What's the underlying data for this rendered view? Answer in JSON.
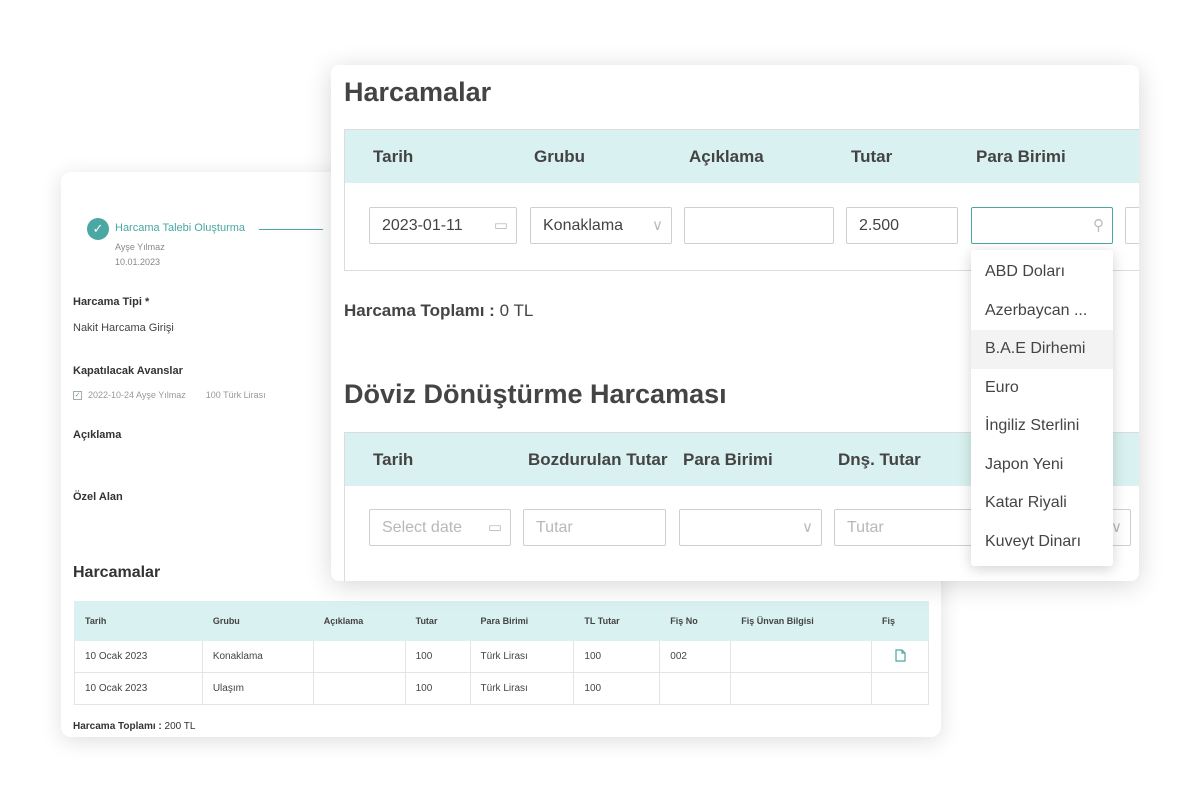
{
  "back": {
    "step": {
      "title": "Harcama Talebi Oluşturma",
      "user": "Ayşe Yılmaz",
      "date": "10.01.2023"
    },
    "fields": {
      "harcama_tipi_label": "Harcama Tipi *",
      "harcama_tipi_value": "Nakit Harcama Girişi",
      "avans_label": "Kapatılacak Avanslar",
      "avans_item": "2022-10-24 Ayşe Yılmaz",
      "avans_amount": "100 Türk Lirası",
      "aciklama_label": "Açıklama",
      "ozel_alan_label": "Özel Alan"
    },
    "table_title": "Harcamalar",
    "columns": [
      "Tarih",
      "Grubu",
      "Açıklama",
      "Tutar",
      "Para Birimi",
      "TL Tutar",
      "Fiş No",
      "Fiş Ünvan Bilgisi",
      "Fiş"
    ],
    "rows": [
      {
        "tarih": "10 Ocak 2023",
        "grubu": "Konaklama",
        "aciklama": "",
        "tutar": "100",
        "para": "Türk Lirası",
        "tl": "100",
        "fisno": "002",
        "unvan": "",
        "fis_icon": "document-icon"
      },
      {
        "tarih": "10 Ocak 2023",
        "grubu": "Ulaşım",
        "aciklama": "",
        "tutar": "100",
        "para": "Türk Lirası",
        "tl": "100",
        "fisno": "",
        "unvan": "",
        "fis_icon": ""
      }
    ],
    "total_label": "Harcama Toplamı :",
    "total_value": "200 TL"
  },
  "front": {
    "title": "Harcamalar",
    "columns": [
      "Tarih",
      "Grubu",
      "Açıklama",
      "Tutar",
      "Para Birimi"
    ],
    "row": {
      "tarih": "2023-01-11",
      "grubu": "Konaklama",
      "aciklama": "",
      "tutar": "2.500",
      "para": ""
    },
    "total_label": "Harcama Toplamı :",
    "total_value": "0 TL",
    "doviz_title": "Döviz Dönüştürme Harcaması",
    "doviz_columns": [
      "Tarih",
      "Bozdurulan Tutar",
      "Para Birimi",
      "Dnş. Tutar"
    ],
    "doviz_row": {
      "tarih_placeholder": "Select date",
      "bozdurulan_placeholder": "Tutar",
      "para": "",
      "dns_placeholder": "Tutar"
    },
    "currency_options": [
      "ABD Doları",
      "Azerbaycan ...",
      "B.A.E Dirhemi",
      "Euro",
      "İngiliz Sterlini",
      "Japon Yeni",
      "Katar Riyali",
      "Kuveyt Dinarı"
    ],
    "highlighted_option": "B.A.E Dirhemi"
  },
  "colors": {
    "accent": "#4aa7a1",
    "header_bg": "#d9f1f0"
  }
}
